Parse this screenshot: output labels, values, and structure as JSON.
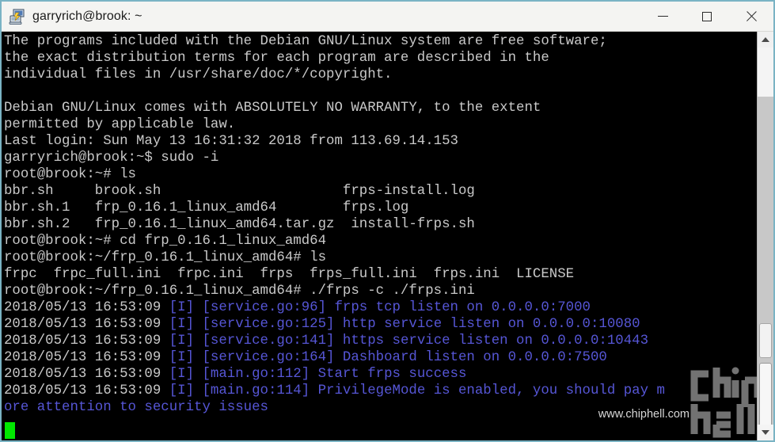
{
  "window": {
    "title": "garryrich@brook: ~",
    "icon": "putty-computer-icon",
    "controls": {
      "minimize_label": "Minimize",
      "maximize_label": "Maximize",
      "close_label": "Close"
    }
  },
  "terminal": {
    "background_color": "#000000",
    "foreground_color": "#c9c9c9",
    "log_color": "#5656d6",
    "cursor_color": "#00e800",
    "lines": [
      {
        "segments": [
          {
            "text": "The programs included with the Debian GNU/Linux system are free software;",
            "color": "gray"
          }
        ]
      },
      {
        "segments": [
          {
            "text": "the exact distribution terms for each program are described in the",
            "color": "gray"
          }
        ]
      },
      {
        "segments": [
          {
            "text": "individual files in /usr/share/doc/*/copyright.",
            "color": "gray"
          }
        ]
      },
      {
        "segments": [
          {
            "text": "",
            "color": "gray"
          }
        ]
      },
      {
        "segments": [
          {
            "text": "Debian GNU/Linux comes with ABSOLUTELY NO WARRANTY, to the extent",
            "color": "gray"
          }
        ]
      },
      {
        "segments": [
          {
            "text": "permitted by applicable law.",
            "color": "gray"
          }
        ]
      },
      {
        "segments": [
          {
            "text": "Last login: Sun May 13 16:31:32 2018 from 113.69.14.153",
            "color": "gray"
          }
        ]
      },
      {
        "segments": [
          {
            "text": "garryrich@brook:~$ sudo -i",
            "color": "gray"
          }
        ]
      },
      {
        "segments": [
          {
            "text": "root@brook:~# ls",
            "color": "gray"
          }
        ]
      },
      {
        "segments": [
          {
            "text": "bbr.sh     brook.sh                      frps-install.log",
            "color": "gray"
          }
        ]
      },
      {
        "segments": [
          {
            "text": "bbr.sh.1   frp_0.16.1_linux_amd64        frps.log",
            "color": "gray"
          }
        ]
      },
      {
        "segments": [
          {
            "text": "bbr.sh.2   frp_0.16.1_linux_amd64.tar.gz  install-frps.sh",
            "color": "gray"
          }
        ]
      },
      {
        "segments": [
          {
            "text": "root@brook:~# cd frp_0.16.1_linux_amd64",
            "color": "gray"
          }
        ]
      },
      {
        "segments": [
          {
            "text": "root@brook:~/frp_0.16.1_linux_amd64# ls",
            "color": "gray"
          }
        ]
      },
      {
        "segments": [
          {
            "text": "frpc  frpc_full.ini  frpc.ini  frps  frps_full.ini  frps.ini  LICENSE",
            "color": "gray"
          }
        ]
      },
      {
        "segments": [
          {
            "text": "root@brook:~/frp_0.16.1_linux_amd64# ./frps -c ./frps.ini",
            "color": "gray"
          }
        ]
      },
      {
        "segments": [
          {
            "text": "2018/05/13 16:53:09 ",
            "color": "gray"
          },
          {
            "text": "[I] [service.go:96] frps tcp listen on 0.0.0.0:7000",
            "color": "blue"
          }
        ]
      },
      {
        "segments": [
          {
            "text": "2018/05/13 16:53:09 ",
            "color": "gray"
          },
          {
            "text": "[I] [service.go:125] http service listen on 0.0.0.0:10080",
            "color": "blue"
          }
        ]
      },
      {
        "segments": [
          {
            "text": "2018/05/13 16:53:09 ",
            "color": "gray"
          },
          {
            "text": "[I] [service.go:141] https service listen on 0.0.0.0:10443",
            "color": "blue"
          }
        ]
      },
      {
        "segments": [
          {
            "text": "2018/05/13 16:53:09 ",
            "color": "gray"
          },
          {
            "text": "[I] [service.go:164] Dashboard listen on 0.0.0.0:7500",
            "color": "blue"
          }
        ]
      },
      {
        "segments": [
          {
            "text": "2018/05/13 16:53:09 ",
            "color": "gray"
          },
          {
            "text": "[I] [main.go:112] Start frps success",
            "color": "blue"
          }
        ]
      },
      {
        "segments": [
          {
            "text": "2018/05/13 16:53:09 ",
            "color": "gray"
          },
          {
            "text": "[I] [main.go:114] PrivilegeMode is enabled, you should pay m",
            "color": "blue"
          }
        ]
      },
      {
        "segments": [
          {
            "text": "ore attention to security issues",
            "color": "blue"
          }
        ]
      }
    ]
  },
  "watermark": {
    "logo_text": "chiphell",
    "url": "www.chiphell.com"
  },
  "scrollbar": {
    "up_arrow": "scroll-up-arrow",
    "down_arrow": "scroll-down-arrow"
  }
}
